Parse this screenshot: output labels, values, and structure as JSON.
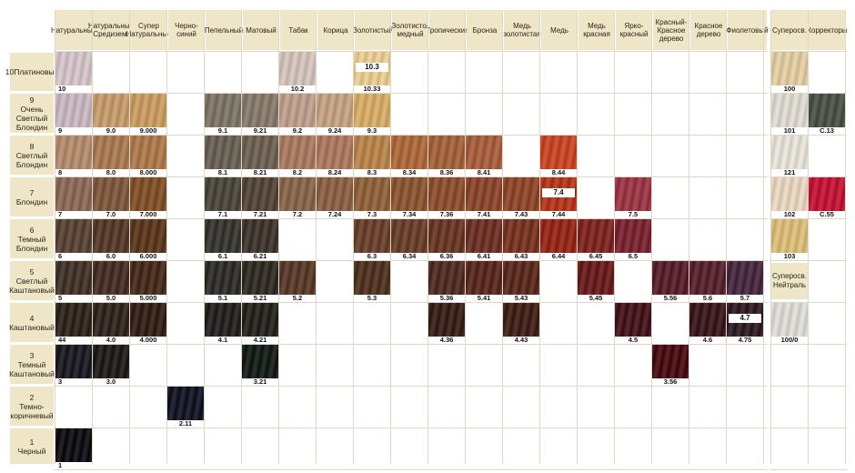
{
  "columns": {
    "natural": "Натуральные",
    "nat_med": "Натуральные Средизем.",
    "super_nat": "Супер Натуральные",
    "black_blue": "Черно-синий",
    "ash": "Пепельный",
    "matte": "Матовый",
    "tobacco": "Табак",
    "cinnamon": "Корица",
    "golden": "Золотистый",
    "gold_copper": "Золотисто-медный",
    "tropical": "Тропические",
    "bronze": "Бронза",
    "copper_gold": "Медь золотистая",
    "copper": "Медь",
    "copper_red": "Медь красная",
    "bright_red": "Ярко-красный",
    "red_mahogany": "Красный-Красное дерево",
    "mahogany": "Красное дерево",
    "violet": "Фиолетовый",
    "superblond": "Суперосв.",
    "correctors": "Корректоры"
  },
  "rows": [
    {
      "level": "10",
      "name": "Платиновый"
    },
    {
      "level": "9",
      "name": "Очень Светлый Блондин"
    },
    {
      "level": "8",
      "name": "Светлый Блондин"
    },
    {
      "level": "7",
      "name": "Блондин"
    },
    {
      "level": "6",
      "name": "Темный Блондин"
    },
    {
      "level": "5",
      "name": "Светлый Каштановый"
    },
    {
      "level": "4",
      "name": "Каштановый"
    },
    {
      "level": "3",
      "name": "Темный Каштановый"
    },
    {
      "level": "2",
      "name": "Темно-коричневый"
    },
    {
      "level": "1",
      "name": "Черный"
    }
  ],
  "swatches": [
    {
      "row": 0,
      "col": 0,
      "code": "10",
      "color": "#cdbfc4"
    },
    {
      "row": 0,
      "col": 6,
      "code": "10.2",
      "color": "#cdbfb8"
    },
    {
      "row": 0,
      "col": 8,
      "code": "10.33",
      "chip": "10.3",
      "color": "#e2c78e"
    },
    {
      "row": 1,
      "col": 0,
      "code": "9",
      "color": "#c4b3bc"
    },
    {
      "row": 1,
      "col": 1,
      "code": "9.0",
      "color": "#c09a6c"
    },
    {
      "row": 1,
      "col": 2,
      "code": "9.000",
      "color": "#c49a62"
    },
    {
      "row": 1,
      "col": 4,
      "code": "9.1",
      "color": "#7d7568"
    },
    {
      "row": 1,
      "col": 5,
      "code": "9.21",
      "color": "#857a6b"
    },
    {
      "row": 1,
      "col": 6,
      "code": "9.2",
      "color": "#b89e8a"
    },
    {
      "row": 1,
      "col": 7,
      "code": "9.24",
      "color": "#c09f82"
    },
    {
      "row": 1,
      "col": 8,
      "code": "9.3",
      "color": "#d1a868"
    },
    {
      "row": 2,
      "col": 0,
      "code": "8",
      "color": "#b08a6c"
    },
    {
      "row": 2,
      "col": 1,
      "code": "8.0",
      "color": "#a67a54"
    },
    {
      "row": 2,
      "col": 2,
      "code": "8.000",
      "color": "#aa7a4e"
    },
    {
      "row": 2,
      "col": 4,
      "code": "8.1",
      "color": "#6a6256"
    },
    {
      "row": 2,
      "col": 5,
      "code": "8.21",
      "color": "#6e6354"
    },
    {
      "row": 2,
      "col": 6,
      "code": "8.2",
      "color": "#a67a62"
    },
    {
      "row": 2,
      "col": 7,
      "code": "8.24",
      "color": "#a87860"
    },
    {
      "row": 2,
      "col": 8,
      "code": "8.3",
      "color": "#b5844e"
    },
    {
      "row": 2,
      "col": 9,
      "code": "8.34",
      "color": "#a86a3e"
    },
    {
      "row": 2,
      "col": 10,
      "code": "8.36",
      "color": "#a0643e"
    },
    {
      "row": 2,
      "col": 11,
      "code": "8.41",
      "color": "#a46040"
    },
    {
      "row": 2,
      "col": 13,
      "code": "8.44",
      "color": "#c4482a"
    },
    {
      "row": 3,
      "col": 0,
      "code": "7",
      "color": "#8a6a58"
    },
    {
      "row": 3,
      "col": 1,
      "code": "7.0",
      "color": "#7e5a40"
    },
    {
      "row": 3,
      "col": 2,
      "code": "7.000",
      "color": "#80532e"
    },
    {
      "row": 3,
      "col": 4,
      "code": "7.1",
      "color": "#4e4a40"
    },
    {
      "row": 3,
      "col": 5,
      "code": "7.21",
      "color": "#56493c"
    },
    {
      "row": 3,
      "col": 6,
      "code": "7.2",
      "color": "#86674e"
    },
    {
      "row": 3,
      "col": 7,
      "code": "7.24",
      "color": "#8a6248"
    },
    {
      "row": 3,
      "col": 8,
      "code": "7.3",
      "color": "#8e6440"
    },
    {
      "row": 3,
      "col": 9,
      "code": "7.34",
      "color": "#8a5836"
    },
    {
      "row": 3,
      "col": 10,
      "code": "7.36",
      "color": "#8a5232"
    },
    {
      "row": 3,
      "col": 11,
      "code": "7.41",
      "color": "#8a4a32"
    },
    {
      "row": 3,
      "col": 12,
      "code": "7.43",
      "color": "#8e4a2e"
    },
    {
      "row": 3,
      "col": 13,
      "code": "7.44",
      "chip": "7.4",
      "color": "#b03a22"
    },
    {
      "row": 3,
      "col": 15,
      "code": "7.5",
      "color": "#9a3a48"
    },
    {
      "row": 4,
      "col": 0,
      "code": "6",
      "color": "#5a463a"
    },
    {
      "row": 4,
      "col": 1,
      "code": "6.0",
      "color": "#583e2e"
    },
    {
      "row": 4,
      "col": 2,
      "code": "6.000",
      "color": "#5e3c24"
    },
    {
      "row": 4,
      "col": 4,
      "code": "6.1",
      "color": "#3c3a34"
    },
    {
      "row": 4,
      "col": 5,
      "code": "6.21",
      "color": "#423a32"
    },
    {
      "row": 4,
      "col": 8,
      "code": "6.3",
      "color": "#6a4430"
    },
    {
      "row": 4,
      "col": 9,
      "code": "6.34",
      "color": "#6a4230"
    },
    {
      "row": 4,
      "col": 10,
      "code": "6.36",
      "color": "#6a3a2a"
    },
    {
      "row": 4,
      "col": 11,
      "code": "6.41",
      "color": "#6e362a"
    },
    {
      "row": 4,
      "col": 12,
      "code": "6.43",
      "color": "#783828"
    },
    {
      "row": 4,
      "col": 13,
      "code": "6.44",
      "color": "#942c1e"
    },
    {
      "row": 4,
      "col": 14,
      "code": "6.45",
      "color": "#7e2a26"
    },
    {
      "row": 4,
      "col": 15,
      "code": "6.5",
      "color": "#7a2a36"
    },
    {
      "row": 5,
      "col": 0,
      "code": "5",
      "color": "#46382e"
    },
    {
      "row": 5,
      "col": 1,
      "code": "5.0",
      "color": "#48342a"
    },
    {
      "row": 5,
      "col": 2,
      "code": "5.000",
      "color": "#4a3022"
    },
    {
      "row": 5,
      "col": 4,
      "code": "5.1",
      "color": "#34322e"
    },
    {
      "row": 5,
      "col": 5,
      "code": "5.21",
      "color": "#36302a"
    },
    {
      "row": 5,
      "col": 6,
      "code": "5.2",
      "color": "#5a3e2e"
    },
    {
      "row": 5,
      "col": 8,
      "code": "5.3",
      "color": "#523626"
    },
    {
      "row": 5,
      "col": 10,
      "code": "5.36",
      "color": "#54302a"
    },
    {
      "row": 5,
      "col": 11,
      "code": "5.41",
      "color": "#5a2e24"
    },
    {
      "row": 5,
      "col": 12,
      "code": "5.43",
      "color": "#5c2e24"
    },
    {
      "row": 5,
      "col": 14,
      "code": "5.45",
      "color": "#6a2222"
    },
    {
      "row": 5,
      "col": 16,
      "code": "5.56",
      "color": "#5a2430"
    },
    {
      "row": 5,
      "col": 17,
      "code": "5.6",
      "color": "#5a2832"
    },
    {
      "row": 5,
      "col": 18,
      "code": "5.7",
      "color": "#4a2e44"
    },
    {
      "row": 6,
      "col": 0,
      "code": "44",
      "color": "#342a24"
    },
    {
      "row": 6,
      "col": 1,
      "code": "4.0",
      "color": "#362a24"
    },
    {
      "row": 6,
      "col": 2,
      "code": "4.000",
      "color": "#38261e"
    },
    {
      "row": 6,
      "col": 4,
      "code": "4.1",
      "color": "#2a2826"
    },
    {
      "row": 6,
      "col": 5,
      "code": "4.21",
      "color": "#2c2824"
    },
    {
      "row": 6,
      "col": 10,
      "code": "4.36",
      "color": "#3e2620"
    },
    {
      "row": 6,
      "col": 12,
      "code": "4.43",
      "color": "#44261e"
    },
    {
      "row": 6,
      "col": 15,
      "code": "4.5",
      "color": "#4a1a22"
    },
    {
      "row": 6,
      "col": 17,
      "code": "4.6",
      "color": "#3e1e22"
    },
    {
      "row": 6,
      "col": 18,
      "code": "4.75",
      "chip": "4.7",
      "color": "#36222a"
    },
    {
      "row": 7,
      "col": 0,
      "code": "3",
      "color": "#222028"
    },
    {
      "row": 7,
      "col": 1,
      "code": "3.0",
      "color": "#262220"
    },
    {
      "row": 7,
      "col": 5,
      "code": "3.21",
      "color": "#1c221e"
    },
    {
      "row": 7,
      "col": 16,
      "code": "3.56",
      "color": "#4a1418"
    },
    {
      "row": 8,
      "col": 3,
      "code": "2.11",
      "color": "#1a1c2a"
    },
    {
      "row": 9,
      "col": 0,
      "code": "1",
      "color": "#16161a"
    }
  ],
  "side_columns": [
    {
      "col": 0,
      "row": 0,
      "code": "100",
      "color": "#dcc8a0"
    },
    {
      "col": 0,
      "row": 1,
      "code": "101",
      "color": "#d8d4cc"
    },
    {
      "col": 1,
      "row": 1,
      "code": "С.13",
      "color": "#4e544a"
    },
    {
      "col": 0,
      "row": 2,
      "code": "121",
      "color": "#e0dcd4"
    },
    {
      "col": 0,
      "row": 3,
      "code": "102",
      "color": "#e0d0bc"
    },
    {
      "col": 1,
      "row": 3,
      "code": "С.55",
      "color": "#c01a3a"
    },
    {
      "col": 0,
      "row": 4,
      "code": "103",
      "color": "#d6b878"
    },
    {
      "col": 0,
      "row": 6,
      "code": "100/0",
      "color": "#d8d4d0"
    }
  ],
  "side_label_neutral": "Суперосв. Нейтраль"
}
